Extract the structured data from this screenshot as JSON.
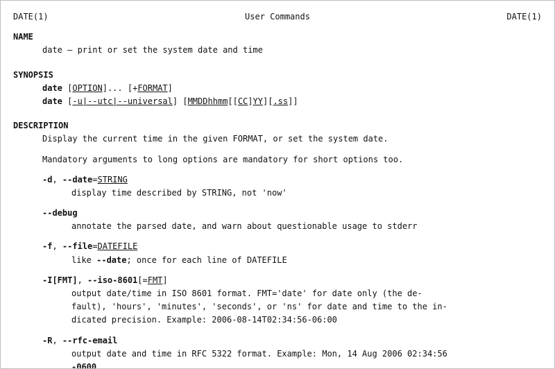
{
  "header": {
    "left": "DATE(1)",
    "center": "User Commands",
    "right": "DATE(1)"
  },
  "name": {
    "heading": "NAME",
    "line": "date – print or set the system date and time"
  },
  "synopsis": {
    "heading": "SYNOPSIS",
    "cmd": "date",
    "line1_tail": "]... [+",
    "option_word": "OPTION",
    "format_word": "FORMAT",
    "close_bracket": "]",
    "line2_flags": "-u|--utc|--universal",
    "line2_mmdd": "MMDDhhmm",
    "line2_cc": "CC",
    "line2_yy": "YY",
    "line2_ss": ".ss",
    "open_bracket": "[",
    "double_open": "[[",
    "close_bracket2": "]",
    "close_bracket3": "]",
    "close_bracket4": "]",
    "close_bracket5": "]",
    "space": " "
  },
  "description": {
    "heading": "DESCRIPTION",
    "p1": "Display the current time in the given FORMAT, or set the system date.",
    "p2": "Mandatory arguments to long options are mandatory for short options too.",
    "opt_d": {
      "short": "-d",
      "sep": ", ",
      "long": "--date",
      "eq": "=",
      "arg": "STRING",
      "desc": "display time described by STRING, not 'now'"
    },
    "opt_debug": {
      "flag": "--debug",
      "desc": "annotate the parsed date, and warn about questionable usage to stderr"
    },
    "opt_f": {
      "short": "-f",
      "sep": ", ",
      "long": "--file",
      "eq": "=",
      "arg": "DATEFILE",
      "desc_pre": "like ",
      "desc_bold": "--date",
      "desc_post": "; once for each line of DATEFILE"
    },
    "opt_I": {
      "short": "-I[FMT]",
      "sep": ", ",
      "long": "--iso-8601",
      "eq_open": "[=",
      "arg": "FMT",
      "close": "]",
      "desc1": "output  date/time  in  ISO  8601  format.  FMT='date' for date only (the de-",
      "desc2": "fault), 'hours', 'minutes', 'seconds', or 'ns' for date and time to the  in-",
      "desc3": "dicated precision.  Example: 2006-08-14T02:34:56-06:00"
    },
    "opt_R": {
      "short": "-R",
      "sep": ", ",
      "long": "--rfc-email",
      "desc1": "output date and time in RFC 5322 format.  Example: Mon, 14 Aug 2006 02:34:56",
      "desc2": "-0600"
    }
  }
}
